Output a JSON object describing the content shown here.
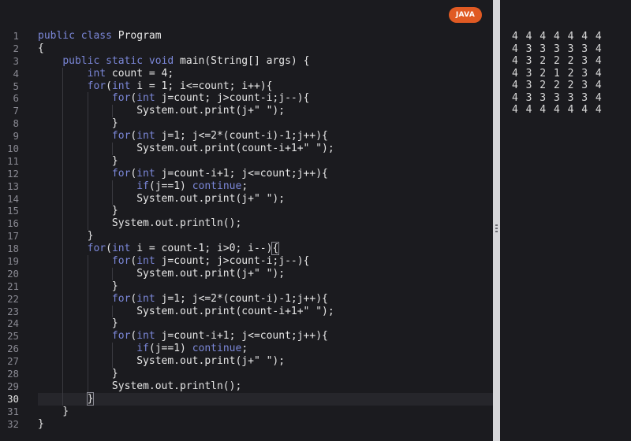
{
  "editor": {
    "language_badge": "JAVA",
    "active_line": 30,
    "lines": [
      "public class Program",
      "{",
      "    public static void main(String[] args) {",
      "        int count = 4;",
      "        for(int i = 1; i<=count; i++){",
      "            for(int j=count; j>count-i;j--){",
      "                System.out.print(j+\" \");",
      "            }",
      "            for(int j=1; j<=2*(count-i)-1;j++){",
      "                System.out.print(count-i+1+\" \");",
      "            }",
      "            for(int j=count-i+1; j<=count;j++){",
      "                if(j==1) continue;",
      "                System.out.print(j+\" \");",
      "            }",
      "            System.out.println();",
      "        }",
      "        for(int i = count-1; i>0; i--){",
      "            for(int j=count; j>count-i;j--){",
      "                System.out.print(j+\" \");",
      "            }",
      "            for(int j=1; j<=2*(count-i)-1;j++){",
      "                System.out.print(count-i+1+\" \");",
      "            }",
      "            for(int j=count-i+1; j<=count;j++){",
      "                if(j==1) continue;",
      "                System.out.print(j+\" \");",
      "            }",
      "            System.out.println();",
      "        }",
      "    }",
      "}"
    ]
  },
  "output": {
    "lines": [
      "4 4 4 4 4 4 4",
      "4 3 3 3 3 3 4",
      "4 3 2 2 2 3 4",
      "4 3 2 1 2 3 4",
      "4 3 2 2 2 3 4",
      "4 3 3 3 3 3 4",
      "4 4 4 4 4 4 4"
    ]
  }
}
